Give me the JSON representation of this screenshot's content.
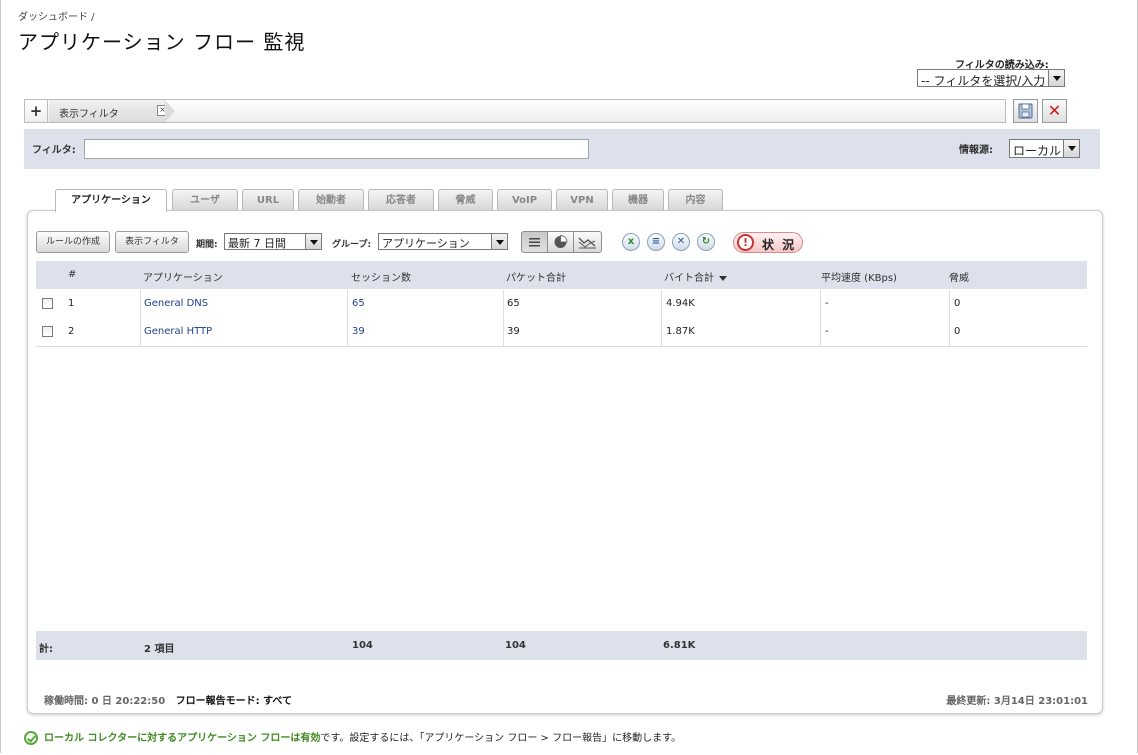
{
  "breadcrumb": "ダッシュボード /",
  "page_title": "アプリケーション フロー 監視",
  "filter_load": {
    "label": "フィルタの読み込み:",
    "selected": "-- フィルタを選択/入力 --"
  },
  "filterbar": {
    "plus": "+",
    "chip_label": "表示フィルタ",
    "chip_close": "×",
    "clear": "✕"
  },
  "filter_panel": {
    "filter_label": "フィルタ:",
    "filter_value": "",
    "source_label": "情報源:",
    "source_selected": "ローカル"
  },
  "tabs": [
    "アプリケーション",
    "ユーザ",
    "URL",
    "始動者",
    "応答者",
    "脅威",
    "VoIP",
    "VPN",
    "機器",
    "内容"
  ],
  "toolbar": {
    "create_rule": "ルールの作成",
    "show_filter": "表示フィルタ",
    "period_label": "期間:",
    "period_selected": "最新 7 日間",
    "group_label": "グループ:",
    "group_selected": "アプリケーション",
    "status_label": "状 況",
    "status_mark": "!"
  },
  "table": {
    "columns": [
      "#",
      "アプリケーション",
      "セッション数",
      "パケット合計",
      "バイト合計",
      "平均速度 (KBps)",
      "脅威"
    ],
    "rows": [
      {
        "num": "1",
        "app": "General DNS",
        "sessions": "65",
        "packets": "65",
        "bytes": "4.94K",
        "speed": "-",
        "threats": "0"
      },
      {
        "num": "2",
        "app": "General HTTP",
        "sessions": "39",
        "packets": "39",
        "bytes": "1.87K",
        "speed": "-",
        "threats": "0"
      }
    ],
    "footer": {
      "label": "計:",
      "items": "2 項目",
      "sessions": "104",
      "packets": "104",
      "bytes": "6.81K"
    }
  },
  "status_bar": {
    "uptime_label": "稼働時間:",
    "uptime_value": "0 日 20:22:50",
    "mode_label": "フロー報告モード:",
    "mode_value": "すべて",
    "last_update": "最終更新: 3月14日 23:01:01"
  },
  "notice": {
    "bold": "ローカル コレクターに対するアプリケーション フローは有効",
    "rest": "です。設定するには、「アプリケーション フロー > フロー報告」に移動します。"
  },
  "colors": {
    "header_band": "#dde1ec",
    "link": "#23408e",
    "alert": "#c33333",
    "ok": "#5aaa3a"
  }
}
